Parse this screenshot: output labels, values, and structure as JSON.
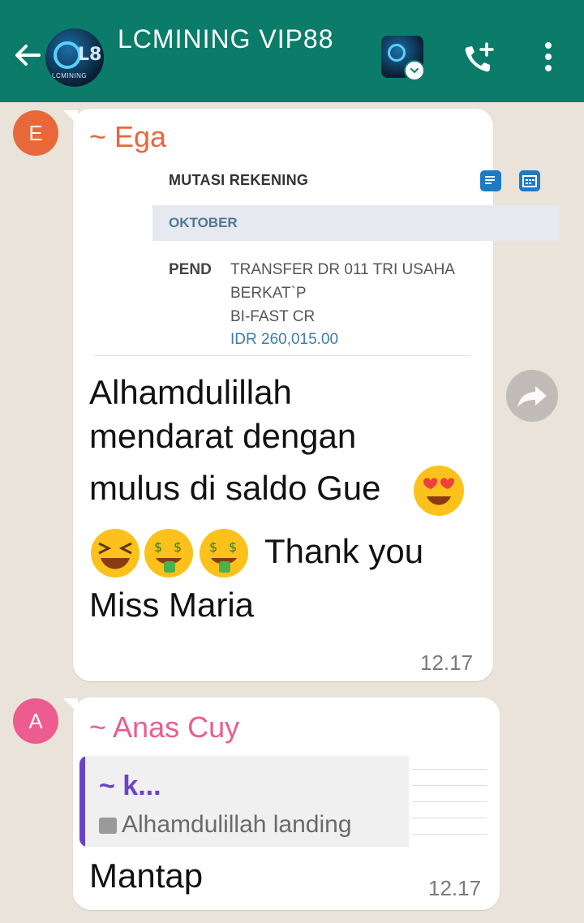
{
  "header": {
    "title": "LCMINING VIP88",
    "avatar_text": "L8",
    "avatar_sub": "LCMINING",
    "back_icon": "arrow-left-icon",
    "call_icon": "add-call-icon",
    "menu_icon": "more-vert-icon"
  },
  "colors": {
    "header_bg": "#0b7c6a",
    "ega": "#e8683a",
    "anas": "#ec5c8e",
    "quote_accent": "#6a43c8"
  },
  "messages": [
    {
      "avatar_letter": "E",
      "sender": "~ Ega",
      "bank_screenshot": {
        "title": "MUTASI REKENING",
        "month": "OKTOBER",
        "status": "PEND",
        "line1": "TRANSFER   DR 011 TRI USAHA",
        "line2": "BERKAT`P",
        "line3": "BI-FAST CR",
        "amount": "IDR 260,015.00"
      },
      "text_line1": "Alhamdulillah",
      "text_line2": "mendarat dengan",
      "text_line3": "mulus di saldo Gue",
      "text_line4": "Thank you",
      "text_line5": "Miss Maria",
      "time": "12.17"
    },
    {
      "avatar_letter": "A",
      "sender": "~ Anas Cuy",
      "quote": {
        "name": "~ k...",
        "text": "Alhamdulillah landing"
      },
      "text": "Mantap",
      "time": "12.17"
    }
  ]
}
